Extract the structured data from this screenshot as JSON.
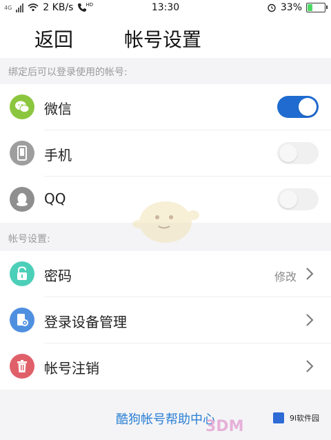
{
  "status_bar": {
    "carrier_tag": "4G",
    "network_speed": "2 KB/s",
    "hd_label": "HD",
    "time": "13:30",
    "battery_percent": "33%",
    "battery_level": 0.33
  },
  "header": {
    "back_label": "返回",
    "title": "帐号设置"
  },
  "bind_section": {
    "label": "绑定后可以登录使用的帐号:",
    "items": [
      {
        "label": "微信",
        "enabled": true,
        "icon": "wechat-icon",
        "color": "#8cc63e"
      },
      {
        "label": "手机",
        "enabled": false,
        "icon": "phone-icon",
        "color": "#9e9e9e"
      },
      {
        "label": "QQ",
        "enabled": false,
        "icon": "qq-icon",
        "color": "#8f8f8f"
      }
    ]
  },
  "account_section": {
    "label": "帐号设置:",
    "items": [
      {
        "label": "密码",
        "value": "修改",
        "icon": "lock-icon",
        "color": "#4ccfb8"
      },
      {
        "label": "登录设备管理",
        "value": "",
        "icon": "device-settings-icon",
        "color": "#4f8fe0"
      },
      {
        "label": "帐号注销",
        "value": "",
        "icon": "trash-icon",
        "color": "#e0606a"
      }
    ]
  },
  "footer": {
    "help_link": "酷狗帐号帮助中心"
  },
  "watermark": {
    "text_3dm": "3DM",
    "site_name": "9l软件园"
  },
  "colors": {
    "accent": "#1f6bd0",
    "link": "#2a7fd4"
  }
}
